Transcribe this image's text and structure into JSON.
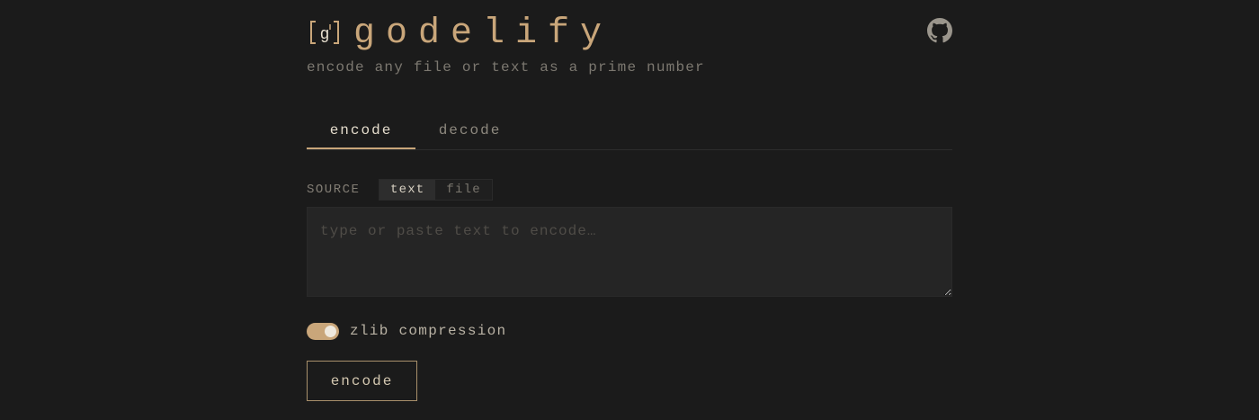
{
  "app": {
    "logo_icon": "bracket-g-logo-icon",
    "title": "godelify",
    "subtitle": "encode any file or text as a prime number",
    "github_icon": "github-icon"
  },
  "tabs": [
    {
      "label": "encode",
      "active": true
    },
    {
      "label": "decode",
      "active": false
    }
  ],
  "source": {
    "label": "SOURCE",
    "options": [
      {
        "label": "text",
        "selected": true
      },
      {
        "label": "file",
        "selected": false
      }
    ],
    "input_value": "",
    "placeholder": "type or paste text to encode…"
  },
  "compression": {
    "label": "zlib compression",
    "enabled": true
  },
  "actions": {
    "encode_label": "encode"
  },
  "colors": {
    "background": "#1b1b1b",
    "accent": "#c9a67a",
    "input_background": "#252525"
  }
}
